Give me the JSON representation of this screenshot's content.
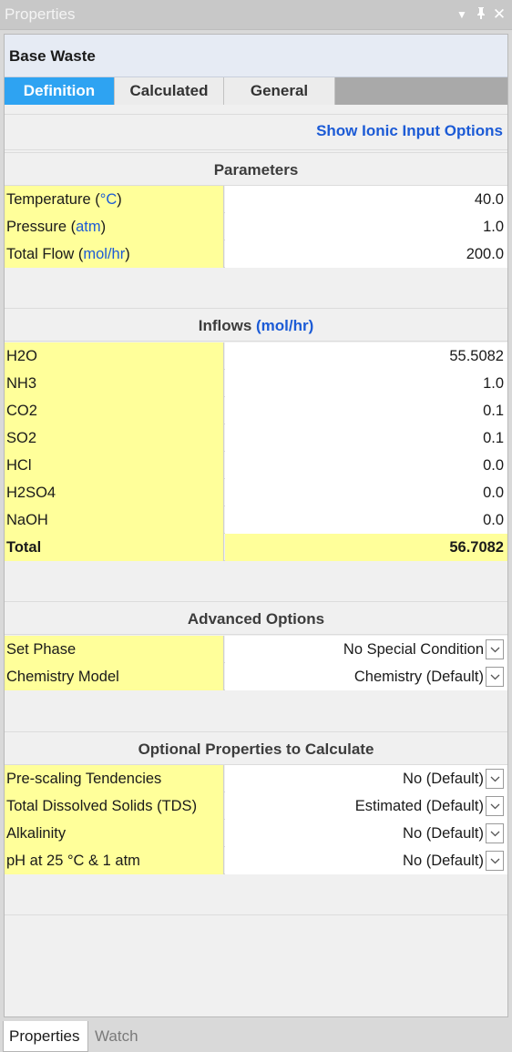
{
  "window": {
    "title": "Properties",
    "controls": [
      "chevron-down-icon",
      "pin-icon",
      "close-icon"
    ]
  },
  "header": {
    "object_name": "Base Waste"
  },
  "tabs": [
    {
      "label": "Definition",
      "active": true
    },
    {
      "label": "Calculated",
      "active": false
    },
    {
      "label": "General",
      "active": false
    }
  ],
  "ionic_link": "Show Ionic Input Options",
  "parameters": {
    "title": "Parameters",
    "rows": [
      {
        "label": "Temperature (",
        "unit": "°C",
        "close": ")",
        "value": "40.0"
      },
      {
        "label": "Pressure (",
        "unit": "atm",
        "close": ")",
        "value": "1.0"
      },
      {
        "label": "Total Flow (",
        "unit": "mol/hr",
        "close": ")",
        "value": "200.0"
      }
    ]
  },
  "inflows": {
    "title": "Inflows ",
    "unit": "(mol/hr)",
    "rows": [
      {
        "label": "H2O",
        "value": "55.5082"
      },
      {
        "label": "NH3",
        "value": "1.0"
      },
      {
        "label": "CO2",
        "value": "0.1"
      },
      {
        "label": "SO2",
        "value": "0.1"
      },
      {
        "label": "HCl",
        "value": "0.0"
      },
      {
        "label": "H2SO4",
        "value": "0.0"
      },
      {
        "label": "NaOH",
        "value": "0.0"
      }
    ],
    "total": {
      "label": "Total",
      "value": "56.7082"
    }
  },
  "advanced": {
    "title": "Advanced Options",
    "rows": [
      {
        "label": "Set Phase",
        "value": "No Special Condition"
      },
      {
        "label": "Chemistry Model",
        "value": "Chemistry (Default)"
      }
    ]
  },
  "optional": {
    "title": "Optional Properties to Calculate",
    "rows": [
      {
        "label": "Pre-scaling Tendencies",
        "value": "No (Default)"
      },
      {
        "label": "Total Dissolved Solids (TDS)",
        "value": "Estimated (Default)"
      },
      {
        "label": "Alkalinity",
        "value": "No (Default)"
      },
      {
        "label": "pH at 25 °C & 1 atm",
        "value": "No (Default)"
      }
    ]
  },
  "bottom_tabs": [
    {
      "label": "Properties",
      "active": true
    },
    {
      "label": "Watch",
      "active": false
    }
  ],
  "colors": {
    "accent": "#2ea3f2",
    "label_bg": "#ffff9a",
    "link": "#1c5bd6"
  }
}
